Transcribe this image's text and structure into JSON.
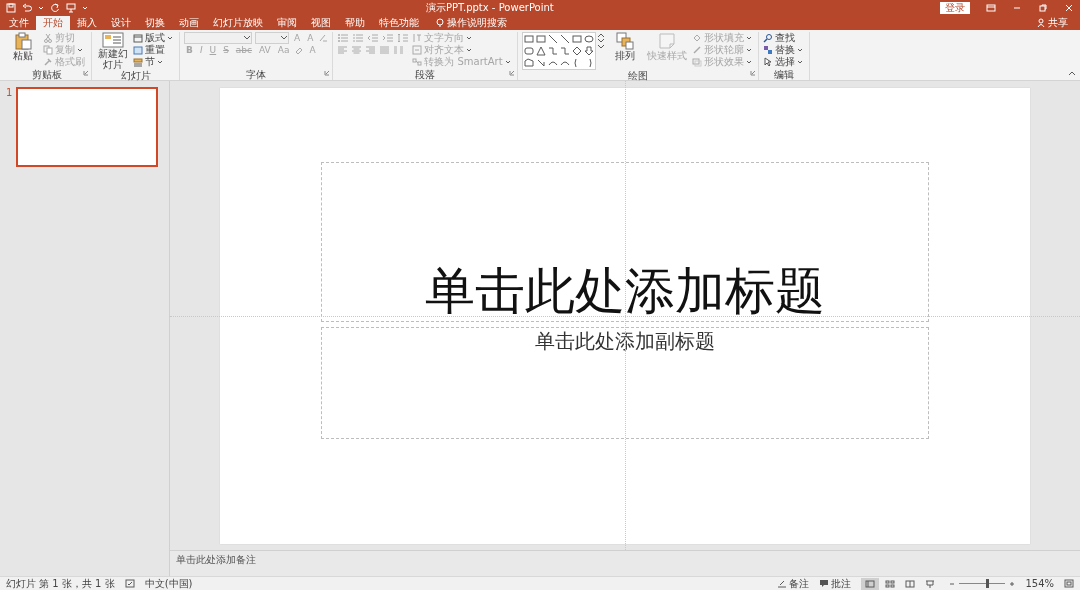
{
  "title_bar": {
    "title": "演示PPT.pptx  -  PowerPoint",
    "login": "登录"
  },
  "tabs": [
    {
      "label": "文件",
      "selected": false
    },
    {
      "label": "开始",
      "selected": true
    },
    {
      "label": "插入",
      "selected": false
    },
    {
      "label": "设计",
      "selected": false
    },
    {
      "label": "切换",
      "selected": false
    },
    {
      "label": "动画",
      "selected": false
    },
    {
      "label": "幻灯片放映",
      "selected": false
    },
    {
      "label": "审阅",
      "selected": false
    },
    {
      "label": "视图",
      "selected": false
    },
    {
      "label": "帮助",
      "selected": false
    },
    {
      "label": "特色功能",
      "selected": false
    }
  ],
  "tell_me": "操作说明搜索",
  "share": "共享",
  "ribbon": {
    "groups": [
      {
        "kind": "clipboard",
        "label": "剪贴板",
        "big": [
          {
            "text": "粘贴",
            "disabled": false
          }
        ],
        "small": [
          {
            "text": "剪切",
            "disabled": true,
            "dropdown": false
          },
          {
            "text": "复制",
            "disabled": true,
            "dropdown": true
          },
          {
            "text": "格式刷",
            "disabled": true,
            "dropdown": false
          }
        ]
      },
      {
        "kind": "slides",
        "label": "幻灯片",
        "big": [
          {
            "text": "新建幻灯片",
            "disabled": false
          }
        ],
        "small": [
          {
            "text": "版式",
            "disabled": false,
            "dropdown": true
          },
          {
            "text": "重置",
            "disabled": false,
            "dropdown": false
          },
          {
            "text": "节",
            "disabled": false,
            "dropdown": true
          }
        ]
      },
      {
        "kind": "font",
        "label": "字体",
        "buttons": [
          {
            "text": "B"
          },
          {
            "text": "I"
          },
          {
            "text": "U"
          },
          {
            "text": "S"
          },
          {
            "text": "abc"
          },
          {
            "text": "AV"
          },
          {
            "text": "Aa"
          }
        ],
        "grow": [
          "A",
          "A"
        ],
        "color_button": "A"
      },
      {
        "kind": "paragraph",
        "label": "段落",
        "small": [
          {
            "text": "文字方向",
            "disabled": true,
            "dropdown": true
          },
          {
            "text": "对齐文本",
            "disabled": true,
            "dropdown": true
          },
          {
            "text": "转换为 SmartArt",
            "disabled": true,
            "dropdown": true
          }
        ]
      },
      {
        "kind": "drawing",
        "label": "绘图",
        "big": [
          {
            "text": "排列",
            "disabled": false
          },
          {
            "text": "快速样式",
            "disabled": true
          }
        ],
        "small": [
          {
            "text": "形状填充",
            "disabled": true,
            "dropdown": true
          },
          {
            "text": "形状轮廓",
            "disabled": true,
            "dropdown": true
          },
          {
            "text": "形状效果",
            "disabled": true,
            "dropdown": true
          }
        ]
      },
      {
        "kind": "editing",
        "label": "编辑",
        "small": [
          {
            "text": "查找",
            "disabled": false,
            "dropdown": false
          },
          {
            "text": "替换",
            "disabled": false,
            "dropdown": true
          },
          {
            "text": "选择",
            "disabled": false,
            "dropdown": true
          }
        ]
      }
    ]
  },
  "thumbnails": [
    {
      "number": "1",
      "selected": true
    }
  ],
  "slide": {
    "title_placeholder": "单击此处添加标题",
    "subtitle_placeholder": "单击此处添加副标题"
  },
  "notes": {
    "placeholder": "单击此处添加备注"
  },
  "status_bar": {
    "slide_info": "幻灯片 第 1 张，共 1 张",
    "language": "中文(中国)",
    "notes": "备注",
    "comments": "批注",
    "views": [
      {
        "selected": true
      },
      {
        "selected": false
      },
      {
        "selected": false
      },
      {
        "selected": false
      }
    ],
    "zoom": {
      "level": 0.6,
      "reading": "154%"
    }
  }
}
